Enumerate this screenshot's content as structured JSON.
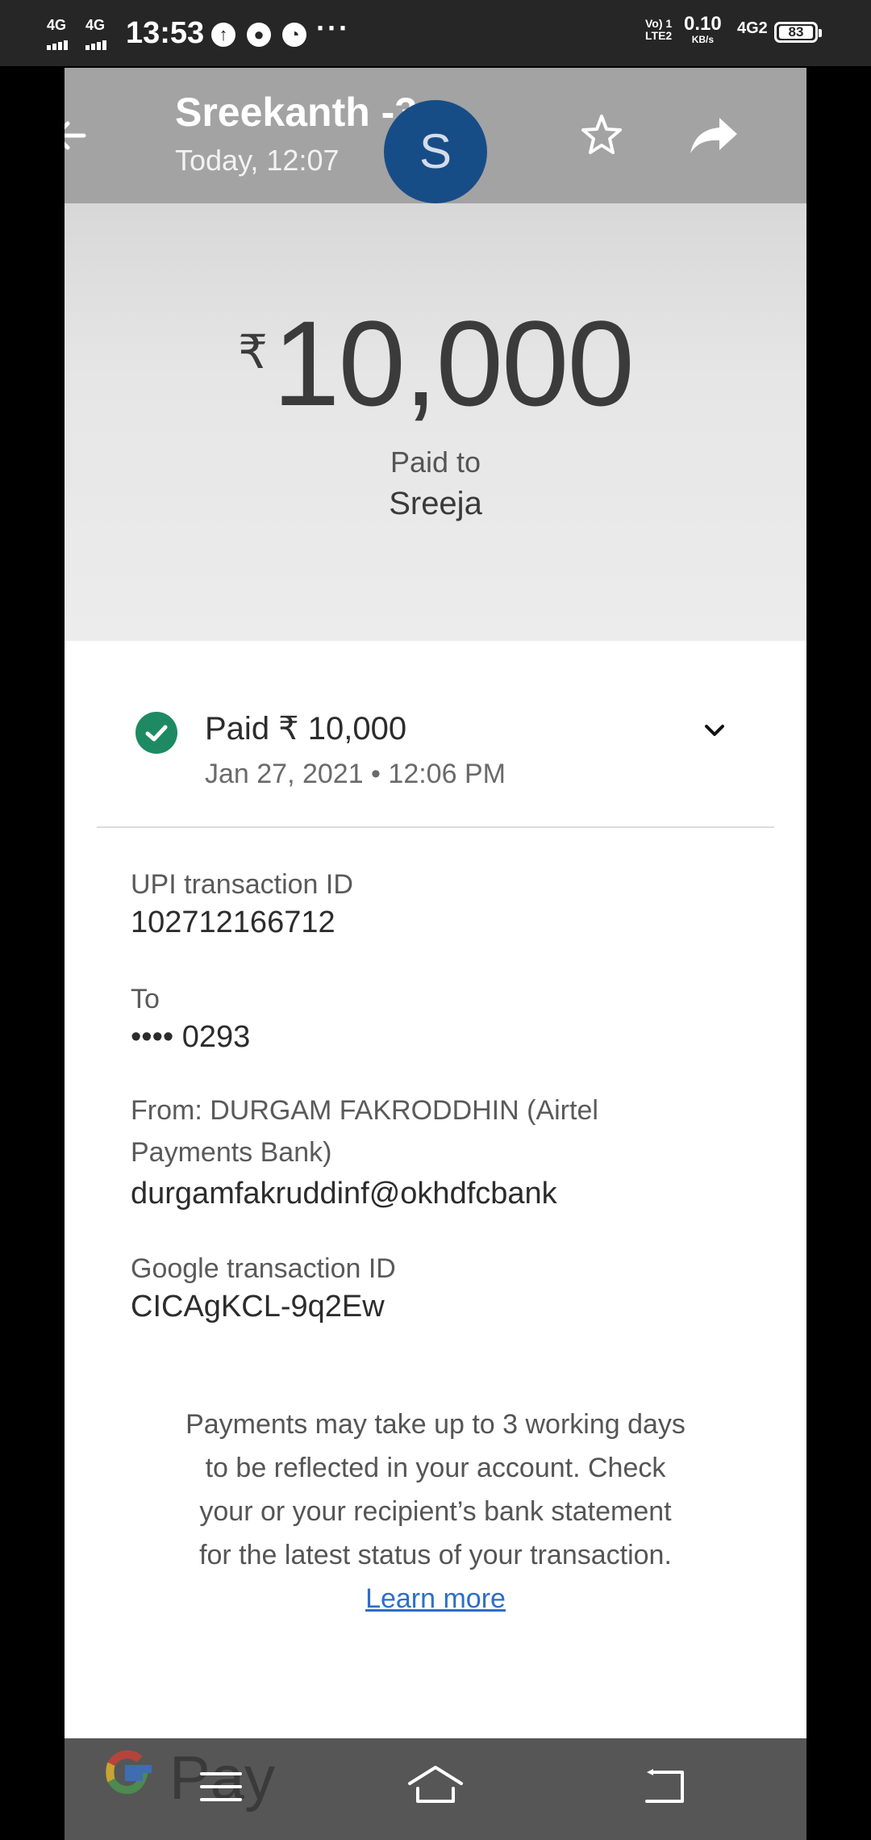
{
  "status_bar": {
    "sim1": "4G",
    "sim2": "4G",
    "time": "13:53",
    "more": "···",
    "volte": "Vo) 1",
    "lte": "LTE2",
    "speed_value": "0.10",
    "speed_unit": "KB/s",
    "network": "4G2",
    "battery": "83"
  },
  "header": {
    "title": "Sreekanth -3",
    "subtitle": "Today, 12:07",
    "avatar_letter": "S"
  },
  "payment": {
    "currency_symbol": "₹",
    "amount": "10,000",
    "paid_to_label": "Paid to",
    "payee": "Sreeja"
  },
  "status": {
    "title": "Paid ₹ 10,000",
    "datetime": "Jan 27, 2021 • 12:06 PM"
  },
  "details": {
    "upi_label": "UPI transaction ID",
    "upi_value": "102712166712",
    "to_label": "To",
    "to_value": "•••• 0293",
    "from_label": "From: DURGAM  FAKRODDHIN (Airtel Payments Bank)",
    "from_value": "durgamfakruddinf@okhdfcbank",
    "google_label": "Google transaction ID",
    "google_value": "CICAgKCL-9q2Ew"
  },
  "note": {
    "text": "Payments may take up to 3 working days to be reflected in your account. Check your or your recipient’s bank statement for the latest status of your transaction.",
    "link": "Learn more"
  },
  "branding": {
    "logo_text": "Pay"
  },
  "colors": {
    "avatar": "#174d87",
    "success": "#1e8a64",
    "link": "#2d6ec8"
  },
  "icons": [
    "back-arrow-icon",
    "star-icon",
    "share-icon",
    "more-vertical-icon",
    "check-circle-icon",
    "chevron-down-icon",
    "menu-icon",
    "home-icon",
    "back-icon"
  ]
}
